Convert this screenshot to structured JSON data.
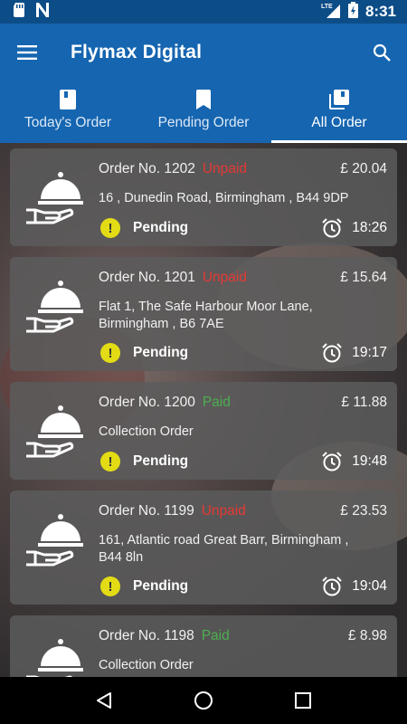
{
  "status_bar": {
    "network": "LTE",
    "time": "8:31"
  },
  "app_bar": {
    "title": "Flymax Digital"
  },
  "tabs": [
    {
      "label": "Today's Order",
      "icon": "book-icon",
      "active": false
    },
    {
      "label": "Pending Order",
      "icon": "bookmark-icon",
      "active": false
    },
    {
      "label": "All Order",
      "icon": "library-icon",
      "active": true
    }
  ],
  "orders": [
    {
      "number": "Order No. 1202",
      "payment": "Unpaid",
      "price": "£ 20.04",
      "address": "16 ,  Dunedin Road, Birmingham , B44 9DP",
      "status": "Pending",
      "time": "18:26"
    },
    {
      "number": "Order No. 1201",
      "payment": "Unpaid",
      "price": "£ 15.64",
      "address": "Flat 1, The Safe Harbour  Moor Lane, Birmingham , B6 7AE",
      "status": "Pending",
      "time": "19:17"
    },
    {
      "number": "Order No. 1200",
      "payment": "Paid",
      "price": "£ 11.88",
      "address": "Collection Order",
      "status": "Pending",
      "time": "19:48"
    },
    {
      "number": "Order No. 1199",
      "payment": "Unpaid",
      "price": "£ 23.53",
      "address": "161, Atlantic road Great Barr, Birmingham , B44 8ln",
      "status": "Pending",
      "time": "19:04"
    },
    {
      "number": "Order No. 1198",
      "payment": "Paid",
      "price": "£ 8.98",
      "address": "Collection Order",
      "status": "",
      "time": ""
    }
  ],
  "colors": {
    "primary": "#1565b0",
    "status_bar": "#0d4d87",
    "unpaid": "#e53935",
    "paid": "#4caf50",
    "warning": "#e3dc15"
  }
}
